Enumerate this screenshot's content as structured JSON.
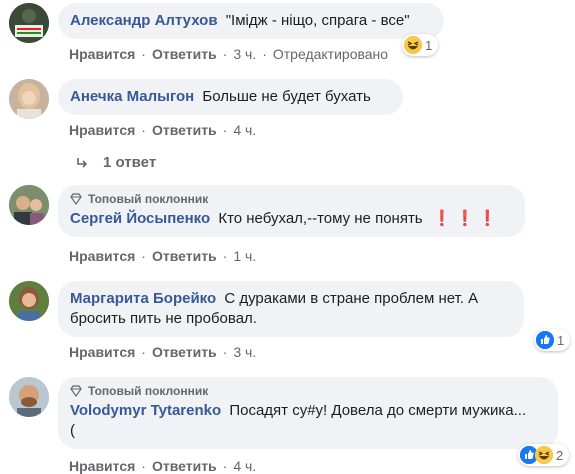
{
  "comments": [
    {
      "author": "Александр Алтухов",
      "text": "\"Імідж - ніщо, спрага - все\"",
      "actions": {
        "like": "Нравится",
        "reply": "Ответить",
        "time": "3 ч.",
        "edited": "Отредактировано"
      },
      "reactions": {
        "icons": [
          "haha-icon"
        ],
        "count": "1"
      }
    },
    {
      "author": "Анечка Малыгон",
      "text": "Больше не будет бухать",
      "actions": {
        "like": "Нравится",
        "reply": "Ответить",
        "time": "4 ч."
      },
      "replies": "1 ответ"
    },
    {
      "badge": "Топовый поклонник",
      "author": "Сергей Йосыпенко",
      "text": "Кто небухал,--тому не понять",
      "emphasis": "❗❗❗",
      "actions": {
        "like": "Нравится",
        "reply": "Ответить",
        "time": "1 ч."
      }
    },
    {
      "author": "Маргарита Борейко",
      "text": "С дураками в стране проблем нет. А",
      "text2": "бросить пить не пробовал.",
      "actions": {
        "like": "Нравится",
        "reply": "Ответить",
        "time": "3 ч."
      },
      "reactions": {
        "icons": [
          "like-icon"
        ],
        "count": "1"
      }
    },
    {
      "badge": "Топовый поклонник",
      "author": "Volodymyr Tytarenko",
      "text": "Посадят су#у! Довела до смерти мужика...",
      "text2": "(",
      "actions": {
        "like": "Нравится",
        "reply": "Ответить",
        "time": "4 ч."
      },
      "reactions": {
        "icons": [
          "like-icon",
          "haha-icon"
        ],
        "count": "2"
      }
    }
  ],
  "colors": {
    "author": "#385898",
    "bubble": "#f0f2f5",
    "meta": "#65676b",
    "like": "#1877f2",
    "haha": "#f7c948"
  }
}
